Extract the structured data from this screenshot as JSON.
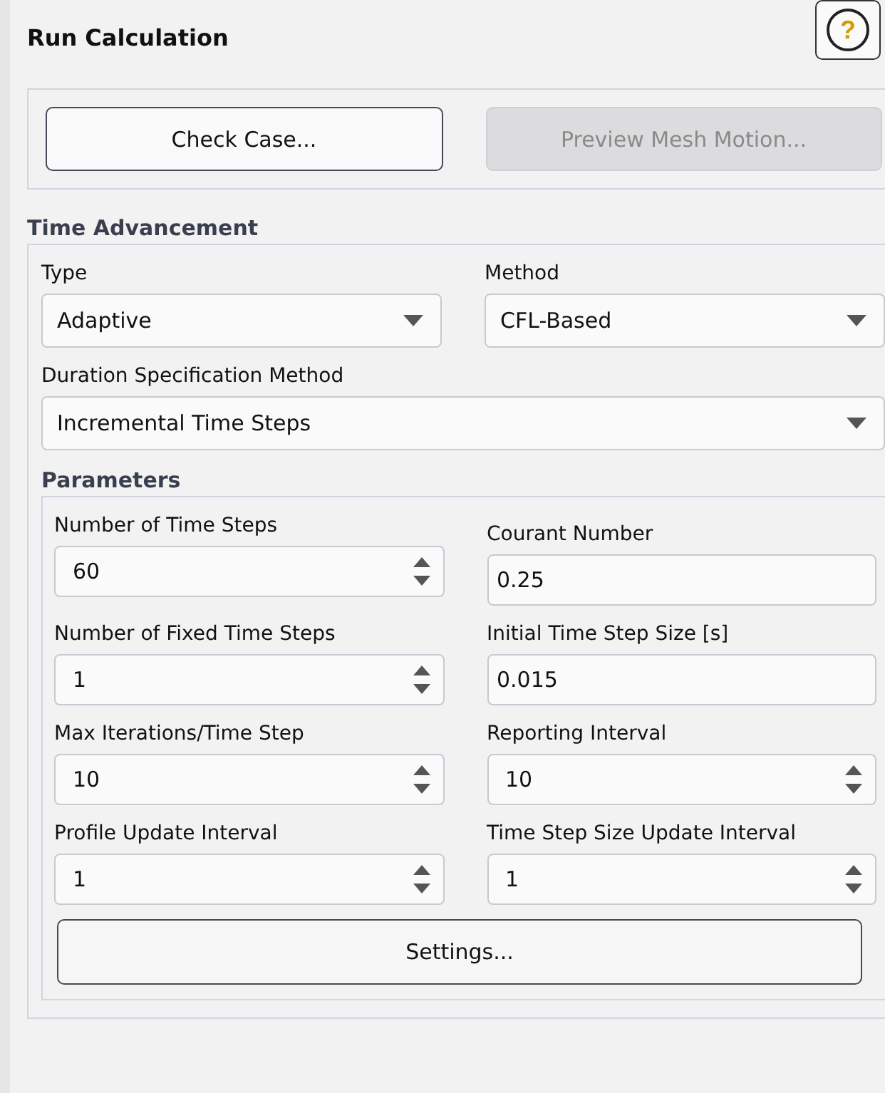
{
  "panel": {
    "title": "Run Calculation",
    "help_button": "?"
  },
  "actions": [
    {
      "label": "Check Case...",
      "disabled": false
    },
    {
      "label": "Preview Mesh Motion...",
      "disabled": true
    }
  ],
  "time_advancement": {
    "heading": "Time Advancement",
    "type": {
      "label": "Type",
      "value": "Adaptive"
    },
    "method": {
      "label": "Method",
      "value": "CFL-Based"
    },
    "duration": {
      "label": "Duration Specification Method",
      "value": "Incremental Time Steps"
    }
  },
  "parameters": {
    "heading": "Parameters",
    "rows": [
      [
        {
          "label": "Number of Time Steps",
          "value": "60",
          "kind": "spinner"
        },
        {
          "label": "Courant Number",
          "value": "0.25",
          "kind": "text"
        }
      ],
      [
        {
          "label": "Number of Fixed Time Steps",
          "value": "1",
          "kind": "spinner"
        },
        {
          "label": "Initial Time Step Size [s]",
          "value": "0.015",
          "kind": "text"
        }
      ],
      [
        {
          "label": "Max Iterations/Time Step",
          "value": "10",
          "kind": "spinner"
        },
        {
          "label": "Reporting Interval",
          "value": "10",
          "kind": "spinner"
        }
      ],
      [
        {
          "label": "Profile Update Interval",
          "value": "1",
          "kind": "spinner"
        },
        {
          "label": "Time Step Size Update Interval",
          "value": "1",
          "kind": "spinner"
        }
      ]
    ],
    "settings_button": "Settings..."
  }
}
